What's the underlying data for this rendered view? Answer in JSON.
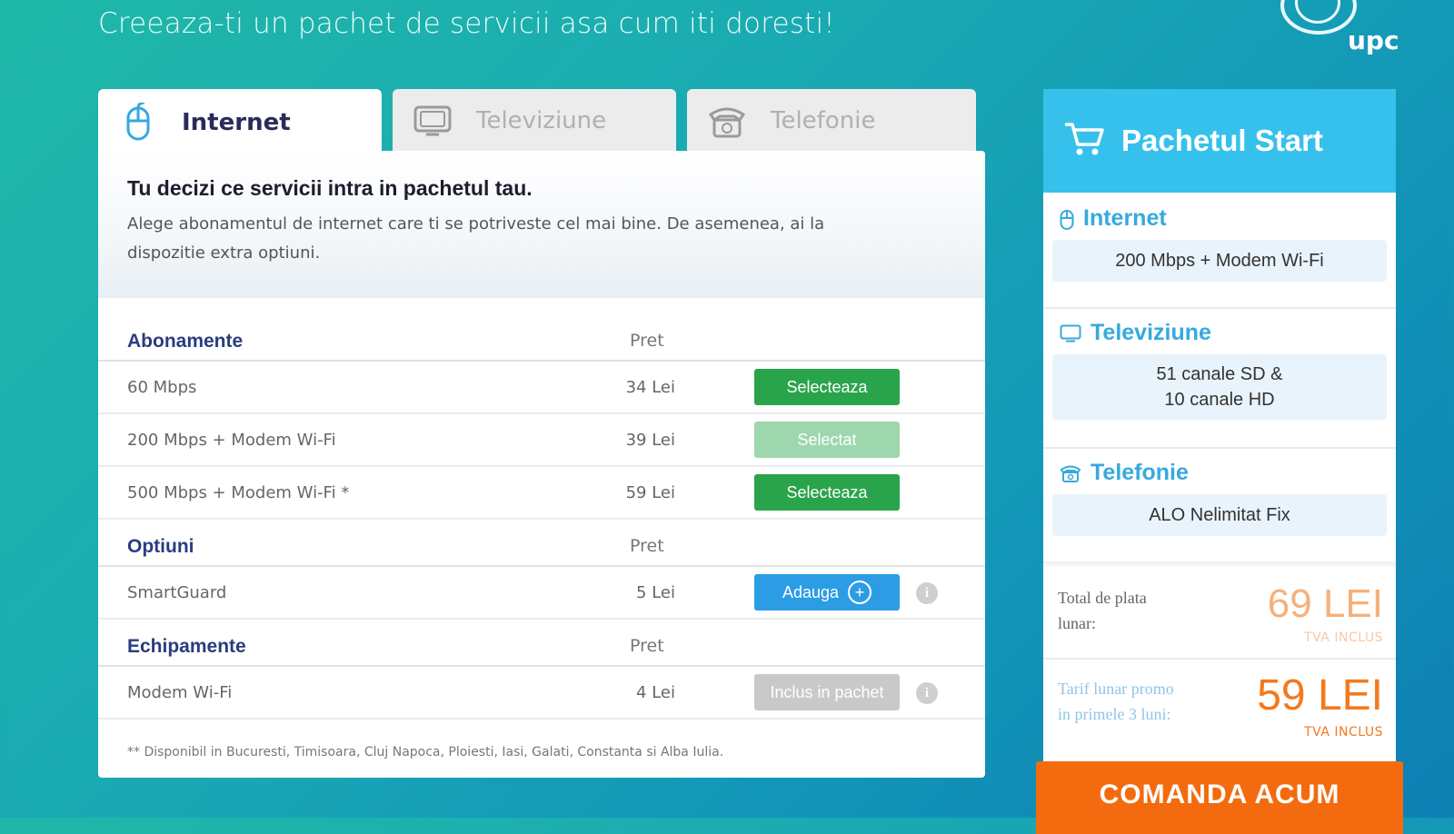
{
  "header": {
    "headline": "Creeaza-ti un pachet de servicii asa cum iti doresti!",
    "logo_text": "upc"
  },
  "tabs": [
    {
      "label": "Internet",
      "icon": "mouse-icon",
      "active": true
    },
    {
      "label": "Televiziune",
      "icon": "tv-icon",
      "active": false
    },
    {
      "label": "Telefonie",
      "icon": "phone-icon",
      "active": false
    }
  ],
  "intro": {
    "title": "Tu decizi ce servicii intra in pachetul tau.",
    "text": "Alege abonamentul de internet care ti se potriveste cel mai bine. De asemenea, ai la dispozitie extra optiuni."
  },
  "sections": {
    "abonamente": {
      "title": "Abonamente",
      "price_header": "Pret",
      "rows": [
        {
          "name": "60 Mbps",
          "price": "34 Lei",
          "button": "Selecteaza"
        },
        {
          "name": "200 Mbps + Modem Wi-Fi",
          "price": "39 Lei",
          "button": "Selectat"
        },
        {
          "name": "500 Mbps + Modem Wi-Fi *",
          "price": "59 Lei",
          "button": "Selecteaza"
        }
      ]
    },
    "optiuni": {
      "title": "Optiuni",
      "price_header": "Pret",
      "rows": [
        {
          "name": "SmartGuard",
          "price": "5 Lei",
          "button": "Adauga",
          "info": "i"
        }
      ]
    },
    "echipamente": {
      "title": "Echipamente",
      "price_header": "Pret",
      "rows": [
        {
          "name": "Modem Wi-Fi",
          "price": "4 Lei",
          "button": "Inclus in pachet",
          "info": "i"
        }
      ]
    }
  },
  "footnote": "** Disponibil in Bucuresti, Timisoara, Cluj Napoca, Ploiesti, Iasi, Galati, Constanta si Alba Iulia.",
  "panel": {
    "title": "Pachetul Start",
    "internet": {
      "label": "Internet",
      "value": "200 Mbps + Modem Wi-Fi"
    },
    "tv": {
      "label": "Televiziune",
      "value_line1": "51 canale SD &",
      "value_line2": "10 canale HD"
    },
    "phone": {
      "label": "Telefonie",
      "value": "ALO Nelimitat Fix"
    },
    "total": {
      "label_line1": "Total de plata",
      "label_line2": "lunar:",
      "price": "69 LEI",
      "tva": "TVA INCLUS"
    },
    "promo": {
      "label_line1": "Tarif lunar promo",
      "label_line2": "in primele 3 luni:",
      "price": "59 LEI",
      "tva": "TVA INCLUS"
    },
    "order_button": "COMANDA ACUM"
  },
  "colors": {
    "accent_green": "#2aa44a",
    "selected_green": "#9ed7ad",
    "blue": "#2c9ce5",
    "panel_blue": "#36c1ec",
    "orange": "#f36b0e",
    "total_orange": "#f6b07a"
  }
}
